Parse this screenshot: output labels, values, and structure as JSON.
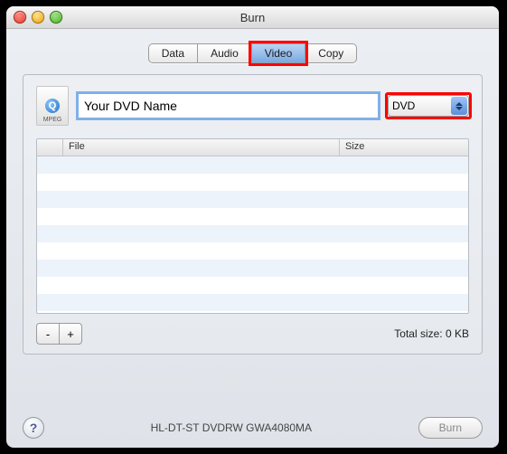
{
  "window": {
    "title": "Burn"
  },
  "tabs": {
    "items": [
      "Data",
      "Audio",
      "Video",
      "Copy"
    ],
    "active_index": 2
  },
  "disc": {
    "name_value": "Your DVD Name",
    "icon_label": "MPEG",
    "type_selected": "DVD"
  },
  "table": {
    "columns": {
      "file": "File",
      "size": "Size"
    },
    "rows": []
  },
  "buttons": {
    "remove": "-",
    "add": "+",
    "burn": "Burn",
    "help": "?"
  },
  "status": {
    "total_label": "Total size: 0 KB",
    "drive": "HL-DT-ST DVDRW GWA4080MA"
  }
}
